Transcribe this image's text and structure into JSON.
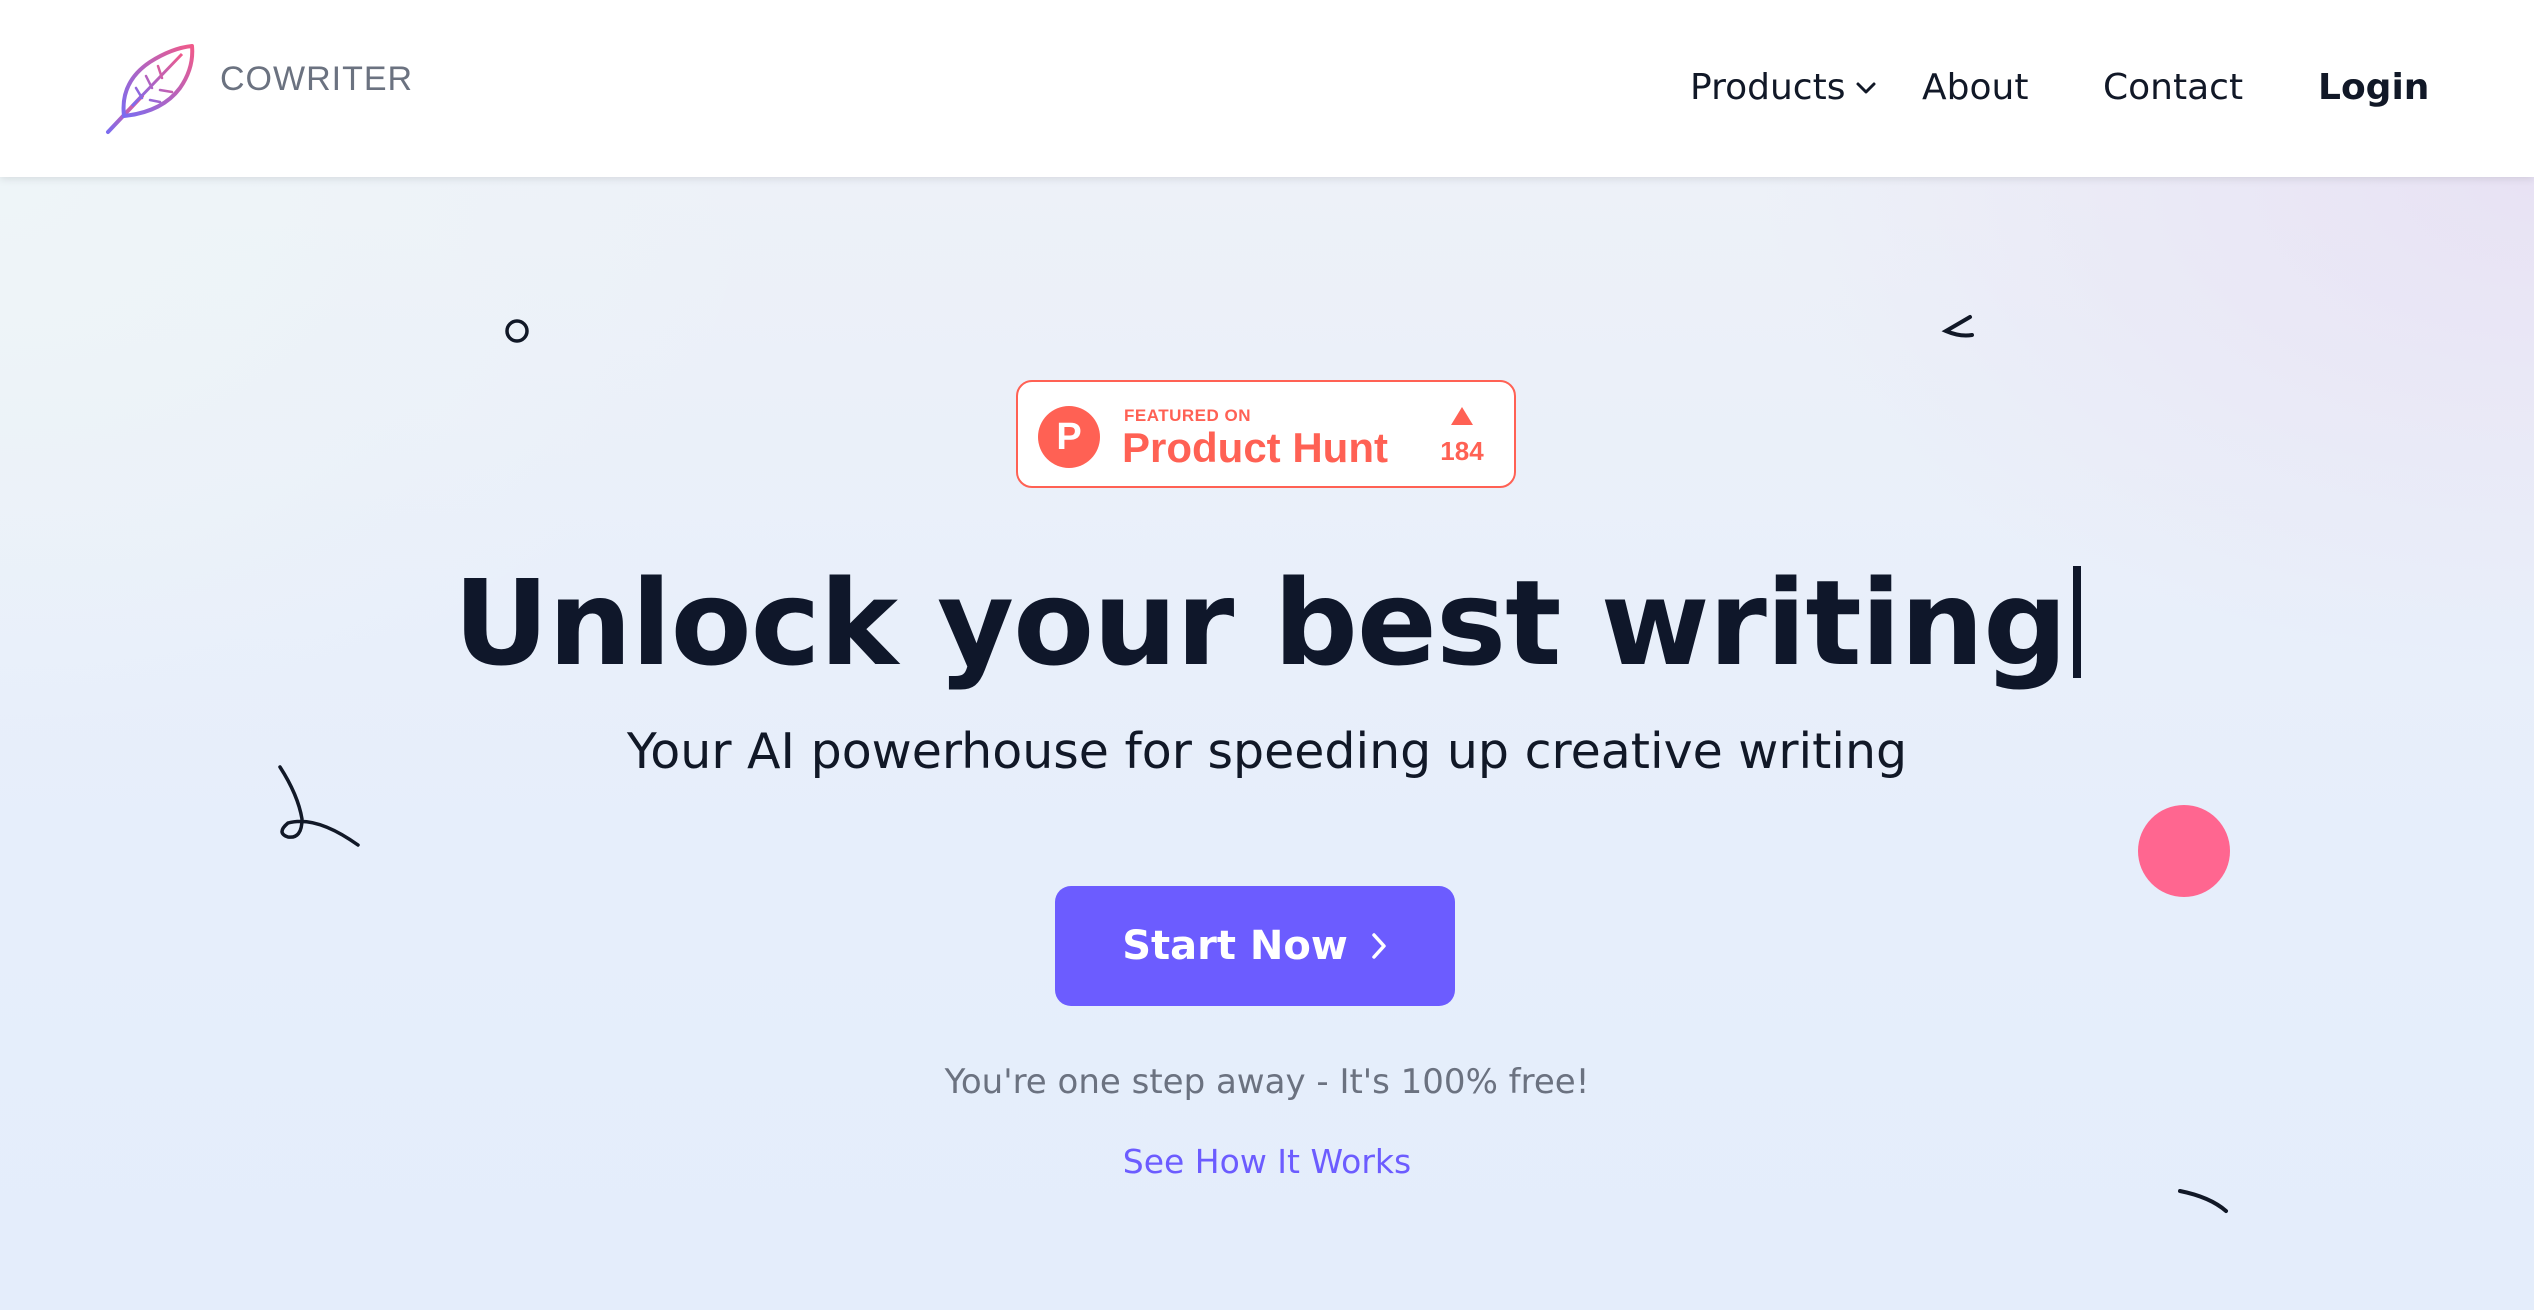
{
  "header": {
    "brand": "COWRITER",
    "logo_icon": "feather-quill-icon",
    "nav": {
      "products": "Products",
      "about": "About",
      "contact": "Contact",
      "login": "Login"
    }
  },
  "badge": {
    "featured_label": "FEATURED ON",
    "name": "Product Hunt",
    "logo_letter": "P",
    "upvotes": "184",
    "color": "#ff6154"
  },
  "hero": {
    "headline": "Unlock your best writing",
    "subheadline": "Your AI powerhouse for speeding up creative writing",
    "cta_label": "Start Now",
    "note": "You're one step away - It's 100% free!",
    "secondary_link": "See How It Works"
  },
  "colors": {
    "accent": "#6c5cff",
    "pink_dot": "#ff6690",
    "heading": "#0f172a",
    "product_hunt": "#ff6154"
  }
}
